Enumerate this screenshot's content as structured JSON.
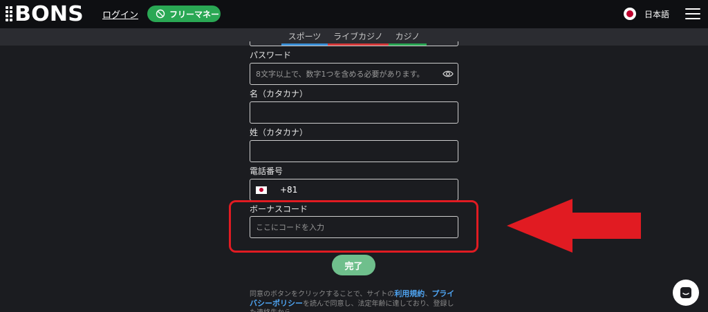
{
  "header": {
    "logo_text": "BONS",
    "login_label": "ログイン",
    "free_money_label": "フリーマネー",
    "language_label": "日本語"
  },
  "tabs": [
    {
      "label": "スポーツ",
      "color": "#3a8fd6"
    },
    {
      "label": "ライブカジノ",
      "color": "#d63a3a"
    },
    {
      "label": "カジノ",
      "color": "#2aa854"
    }
  ],
  "form": {
    "password_label": "パスワード",
    "password_placeholder": "8文字以上で、数字1つを含める必要があります。",
    "first_name_label": "名（カタカナ）",
    "first_name_value": "",
    "last_name_label": "姓（カタカナ）",
    "last_name_value": "",
    "phone_label": "電話番号",
    "phone_code": "+81",
    "bonus_label": "ボーナスコード",
    "bonus_placeholder": "ここにコードを入力",
    "submit_label": "完了"
  },
  "terms": {
    "text_before": "同意のボタンをクリックすることで、サイトの",
    "link_terms": "利用規約",
    "sep": "、",
    "link_privacy": "プライバシーポリシー",
    "text_after": "を読んで同意し、法定年齢に達しており、登録した連絡先から"
  },
  "colors": {
    "accent_green": "#2aa854",
    "highlight_red": "#e11b22",
    "link_blue": "#4ea3f0"
  }
}
